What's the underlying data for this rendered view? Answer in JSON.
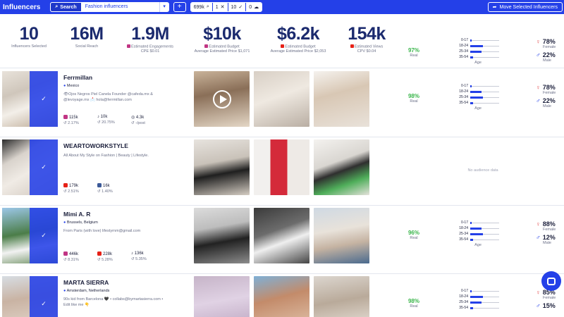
{
  "topbar": {
    "brand": "Influencers",
    "search_label": "Search",
    "search_value": "Fashion influencers",
    "plus": "+",
    "count_value": "699k",
    "selected_value": "1",
    "page_size": "10",
    "cloud_count": "0",
    "move_label": "Move Selected Influencers"
  },
  "summary": {
    "stats": [
      {
        "num": "10",
        "label": "Influencers Selected",
        "sub": ""
      },
      {
        "num": "16M",
        "label": "Social Reach",
        "sub": ""
      },
      {
        "num": "1.9M",
        "label": "Estimated Engagements",
        "sub": "CPE $0.01"
      },
      {
        "num": "$10k",
        "label": "Estimated Budget",
        "sub": "Average Estimated Price $1,071"
      },
      {
        "num": "$6.2k",
        "label": "Estimated Budget",
        "sub": "Average Estimated Price $2,053"
      },
      {
        "num": "154k",
        "label": "Estimated Views",
        "sub": "CPV $0.04"
      }
    ],
    "real_pct": "97%",
    "real_label": "Real",
    "age": {
      "labels": [
        "0-17",
        "18-24",
        "25-34",
        "35-54"
      ],
      "fills": [
        0.05,
        0.45,
        0.4,
        0.1
      ],
      "title": "Age"
    },
    "female_pct": "78%",
    "male_pct": "22%",
    "female_label": "Female",
    "male_label": "Male"
  },
  "rows": [
    {
      "name": "Ferrmillan",
      "location": "Mexico",
      "bio": "👁Ojos Negros Piel Canela Founder @cafeda.mx & @levoyage.mx 📩 hola@ferrmillan.com",
      "metrics": [
        {
          "icon": "instagram",
          "value": "115k",
          "eng": "2.17%"
        },
        {
          "icon": "tiktok",
          "value": "10k",
          "eng": "20.75%"
        },
        {
          "icon": "views",
          "value": "4.3k",
          "eng": "-/post"
        }
      ],
      "real_pct": "98%",
      "age_fills": [
        0.05,
        0.4,
        0.45,
        0.1
      ],
      "female_pct": "78%",
      "male_pct": "22%",
      "has_audience": true
    },
    {
      "name": "WEARTOWORKSTYLE",
      "location": "",
      "bio": "All About My Style on Fashion | Beauty | Lifestyle.",
      "metrics": [
        {
          "icon": "youtube",
          "value": "179k",
          "eng": "2.51%"
        },
        {
          "icon": "facebook",
          "value": "16k",
          "eng": "1.40%"
        }
      ],
      "no_audience": "No audience data",
      "has_audience": false
    },
    {
      "name": "Mimi A. R",
      "location": "Brussels, Belgium",
      "bio": "From Paris (with love) lifestyrnm@gmail.com",
      "metrics": [
        {
          "icon": "instagram",
          "value": "446k",
          "eng": "8.31%"
        },
        {
          "icon": "youtube",
          "value": "228k",
          "eng": "5.28%"
        },
        {
          "icon": "tiktok",
          "value": "136k",
          "eng": "5.35%"
        }
      ],
      "real_pct": "96%",
      "age_fills": [
        0.05,
        0.4,
        0.45,
        0.1
      ],
      "female_pct": "88%",
      "male_pct": "12%",
      "has_audience": true
    },
    {
      "name": "MARTA SIERRA",
      "location": "Amsterdam, Netherlands",
      "bio": "90s kid from Barcelona 🖤 • collabs@bymartasierra.com • Edit like me 👇",
      "metrics": [],
      "real_pct": "98%",
      "age_fills": [
        0.05,
        0.45,
        0.4,
        0.1
      ],
      "female_pct": "85%",
      "male_pct": "15%",
      "has_audience": true
    }
  ],
  "colors": {
    "brand": "#2440e8",
    "real": "#39b54a",
    "female": "#e2484b"
  }
}
